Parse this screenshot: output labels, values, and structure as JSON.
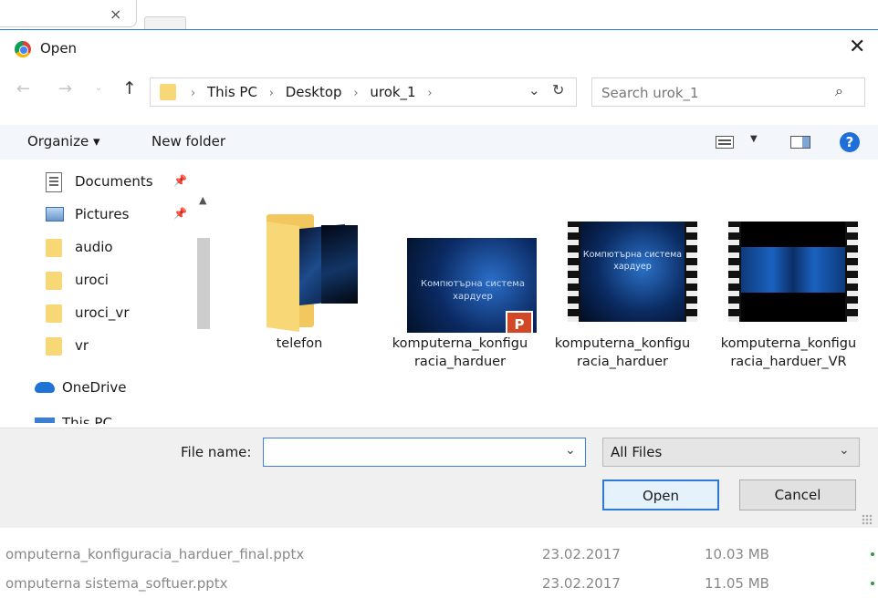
{
  "background": {
    "tab_close": "×",
    "downloads": [
      {
        "name": "omputerna_konfiguracia_harduer_final.pptx",
        "date": "23.02.2017",
        "size": "10.03 MB"
      },
      {
        "name": "omputerna sistema_softuer.pptx",
        "date": "23.02.2017",
        "size": "11.05 MB"
      }
    ]
  },
  "dialog": {
    "title": "Open",
    "close_label": "✕",
    "nav": {
      "back": "←",
      "forward": "→",
      "recent": "⌄",
      "up": "↑"
    },
    "address": {
      "crumbs": [
        "This PC",
        "Desktop",
        "urok_1"
      ],
      "separator": "›",
      "chevron": "⌄",
      "refresh": "↻"
    },
    "search": {
      "placeholder": "Search urok_1",
      "icon": "⌕"
    },
    "toolbar": {
      "organize": "Organize ▾",
      "new_folder": "New folder",
      "view_drop": "▼",
      "help": "?"
    },
    "nav_pane": {
      "items": [
        {
          "label": "Documents",
          "icon": "documents-icon",
          "pinned": true
        },
        {
          "label": "Pictures",
          "icon": "pictures-icon",
          "pinned": true
        },
        {
          "label": "audio",
          "icon": "folder-icon"
        },
        {
          "label": "uroci",
          "icon": "folder-icon"
        },
        {
          "label": "uroci_vr",
          "icon": "folder-icon"
        },
        {
          "label": "vr",
          "icon": "folder-icon"
        }
      ],
      "onedrive": "OneDrive",
      "this_pc": "This PC",
      "pin_glyph": "📌",
      "scroll_up": "▲",
      "scroll_down": "▼"
    },
    "files": [
      {
        "name": "telefon",
        "type": "folder"
      },
      {
        "name": "komputerna_konfiguracia_harduer",
        "type": "pptx",
        "thumb_text": "Компютърна система хардуер"
      },
      {
        "name": "komputerna_konfiguracia_harduer",
        "type": "video",
        "thumb_text": "Компютърна система хардуер"
      },
      {
        "name": "komputerna_konfiguracia_harduer_VR",
        "type": "video"
      }
    ],
    "bottom": {
      "file_name_label": "File name:",
      "file_name_value": "",
      "filter": "All Files",
      "open_button": "Open",
      "cancel_button": "Cancel"
    }
  }
}
